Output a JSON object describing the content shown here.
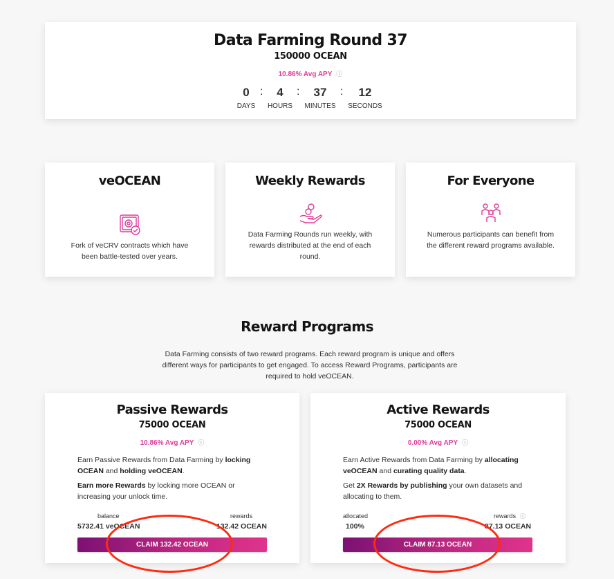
{
  "round": {
    "title": "Data Farming Round 37",
    "amount": "150000 OCEAN",
    "apy": "10.86% Avg APY",
    "countdown": [
      {
        "value": "0",
        "label": "DAYS"
      },
      {
        "value": "4",
        "label": "HOURS"
      },
      {
        "value": "37",
        "label": "MINUTES"
      },
      {
        "value": "12",
        "label": "SECONDS"
      }
    ],
    "separator": ":"
  },
  "features": [
    {
      "title": "veOCEAN",
      "icon": "vault-check-icon",
      "description": "Fork of veCRV contracts which have been battle-tested over years."
    },
    {
      "title": "Weekly Rewards",
      "icon": "hand-coins-icon",
      "description": "Data Farming Rounds run weekly, with rewards distributed at the end of each round."
    },
    {
      "title": "For Everyone",
      "icon": "people-group-icon",
      "description": "Numerous participants can benefit from the different reward programs available."
    }
  ],
  "reward_programs": {
    "title": "Reward Programs",
    "description": "Data Farming consists of two reward programs. Each reward program is unique and offers different ways for participants to get engaged. To access Reward Programs, participants are required to hold veOCEAN."
  },
  "passive": {
    "title": "Passive Rewards",
    "amount": "75000 OCEAN",
    "apy": "10.86% Avg APY",
    "p1_a": "Earn Passive Rewards from Data Farming by ",
    "p1_b": "locking OCEAN",
    "p1_c": " and ",
    "p1_d": "holding veOCEAN",
    "p1_e": ".",
    "p2_a": "Earn more Rewards",
    "p2_b": " by locking more OCEAN or increasing your unlock time.",
    "left_label": "balance",
    "left_value": "5732.41 veOCEAN",
    "right_label": "rewards",
    "right_value": "132.42 OCEAN",
    "claim": "CLAIM 132.42 OCEAN"
  },
  "active": {
    "title": "Active Rewards",
    "amount": "75000 OCEAN",
    "apy": "0.00% Avg APY",
    "p1_a": "Earn Active Rewards from Data Farming by ",
    "p1_b": "allocating veOCEAN",
    "p1_c": " and ",
    "p1_d": "curating quality data",
    "p1_e": ".",
    "p2_a": "Get ",
    "p2_b": "2X Rewards by publishing",
    "p2_c": " your own datasets and allocating to them.",
    "left_label": "allocated",
    "left_value": "100%",
    "right_label": "rewards",
    "right_value": "87.13 OCEAN",
    "claim": "CLAIM 87.13 OCEAN"
  },
  "colors": {
    "accent": "#e03a9a",
    "button_start": "#7b1173",
    "button_end": "#e0338c",
    "highlight_ring": "#ff2a10"
  }
}
